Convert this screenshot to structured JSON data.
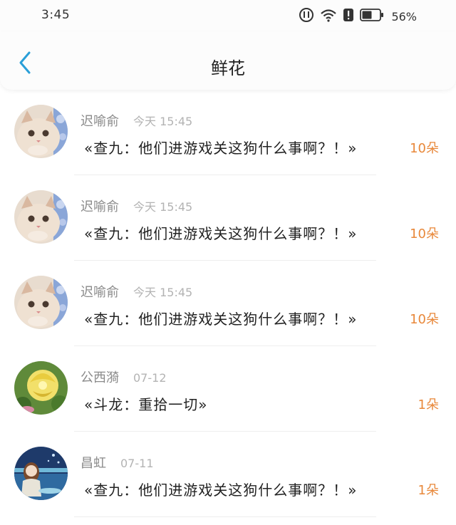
{
  "status_bar": {
    "time": "3:45",
    "battery_percent": "56%",
    "icons": [
      "alarm-icon",
      "wifi-icon",
      "alert-icon",
      "battery-icon"
    ]
  },
  "nav": {
    "back_icon": "chevron-left-icon",
    "title": "鲜花"
  },
  "colors": {
    "accent": "#2a9fd8",
    "count": "#e8883a",
    "name": "#8a8a8a",
    "date": "#b3b3b3"
  },
  "items": [
    {
      "name": "迟喻俞",
      "date": "今天 15:45",
      "message": "«查九：他们进游戏关这狗什么事啊？！»",
      "count": "10朵",
      "avatar": "cat"
    },
    {
      "name": "迟喻俞",
      "date": "今天 15:45",
      "message": "«查九：他们进游戏关这狗什么事啊？！»",
      "count": "10朵",
      "avatar": "cat"
    },
    {
      "name": "迟喻俞",
      "date": "今天 15:45",
      "message": "«查九：他们进游戏关这狗什么事啊？！»",
      "count": "10朵",
      "avatar": "cat"
    },
    {
      "name": "公西漪",
      "date": "07-12",
      "message": "«斗龙：重拾一切»",
      "count": "1朵",
      "avatar": "flower"
    },
    {
      "name": "昌虹",
      "date": "07-11",
      "message": "«查九：他们进游戏关这狗什么事啊？！»",
      "count": "1朵",
      "avatar": "anime-girl"
    }
  ]
}
